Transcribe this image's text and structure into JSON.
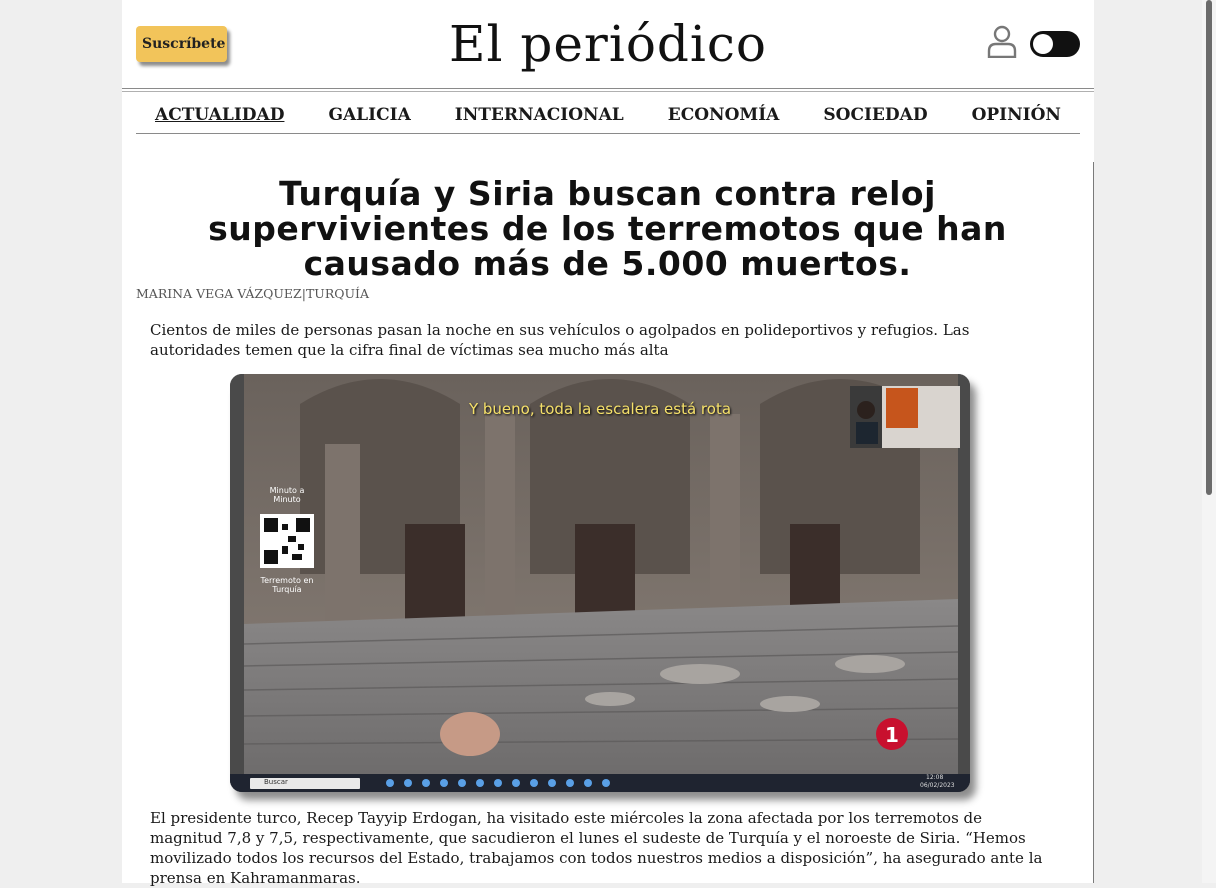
{
  "header": {
    "subscribe_label": "Suscríbete",
    "logo": "El periódico"
  },
  "nav": {
    "items": [
      "ACTUALIDAD",
      "GALICIA",
      "INTERNACIONAL",
      "ECONOMÍA",
      "SOCIEDAD",
      "OPINIÓN"
    ],
    "active": "ACTUALIDAD"
  },
  "article": {
    "title": "Turquía y Siria buscan contra reloj supervivientes de los terremotos que han causado más de 5.000 muertos.",
    "byline": "MARINA VEGA VÁZQUEZ|TURQUÍA",
    "lead": "Cientos de miles de personas pasan la noche en sus vehículos o agolpados en polideportivos y refugios. Las autoridades temen que la cifra final de víctimas sea mucho más alta",
    "body": "El presidente turco, Recep Tayyip Erdogan, ha visitado este miércoles la zona afectada por los terremotos de magnitud 7,8 y 7,5, respectivamente, que sacudieron el lunes el sudeste de Turquía y el noroeste de Siria. “Hemos movilizado todos los recursos del Estado, trabajamos con todos nuestros medios a disposición”, ha asegurado ante la prensa en Kahramanmaras."
  },
  "video": {
    "subtitle": "Y bueno, toda la escalera está rota",
    "qr_top_label": "Minuto a Minuto",
    "qr_bottom_label": "Terremoto en Turquía",
    "channel_logo": "1",
    "taskbar_search": "Buscar",
    "taskbar_time": "12:08",
    "taskbar_date": "06/02/2023"
  },
  "colors": {
    "subscribe_bg": "#f2c45a",
    "toggle_bg": "#111111"
  }
}
